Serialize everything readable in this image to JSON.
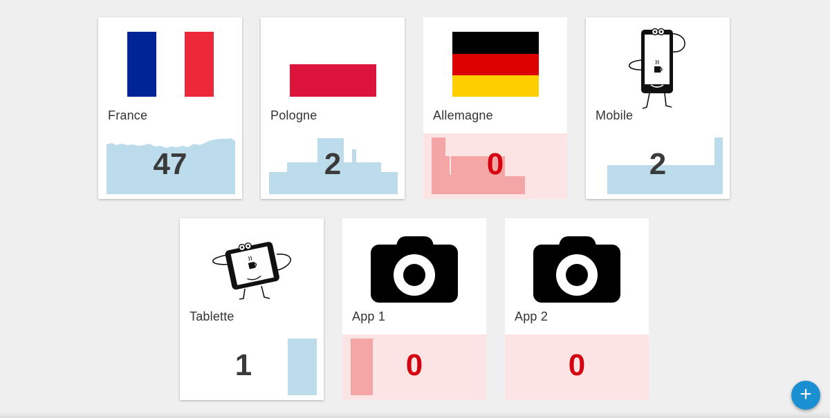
{
  "tiles": [
    {
      "name": "France",
      "count": "47",
      "icon": "france-flag-icon",
      "status": "normal"
    },
    {
      "name": "Pologne",
      "count": "2",
      "icon": "poland-flag-icon",
      "status": "normal"
    },
    {
      "name": "Allemagne",
      "count": "0",
      "icon": "germany-flag-icon",
      "status": "alert"
    },
    {
      "name": "Mobile",
      "count": "2",
      "icon": "mobile-phone-icon",
      "status": "normal"
    },
    {
      "name": "Tablette",
      "count": "1",
      "icon": "tablet-icon",
      "status": "normal"
    },
    {
      "name": "App 1",
      "count": "0",
      "icon": "camera-icon",
      "status": "alert"
    },
    {
      "name": "App 2",
      "count": "0",
      "icon": "camera-icon",
      "status": "alert"
    }
  ],
  "fab": {
    "icon": "plus-icon",
    "label": "+"
  },
  "colors": {
    "background": "#efefef",
    "spark_normal": "#bcdcec",
    "spark_alert": "#f4a6a6",
    "alert_bg": "#fce4e4",
    "alert_text": "#d40010",
    "fab": "#1a8fd1"
  }
}
